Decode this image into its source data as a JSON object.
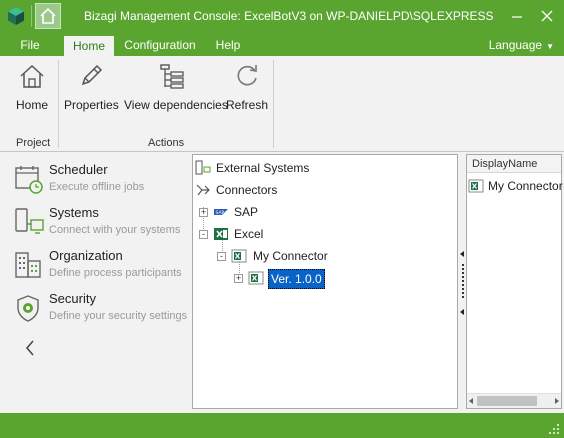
{
  "window": {
    "title": "Bizagi Management Console: ExcelBotV3 on WP-DANIELPD\\SQLEXPRESS",
    "controls": [
      "minimize",
      "close"
    ],
    "accent_color": "#5aa530"
  },
  "ribbon": {
    "tabs": [
      {
        "label": "File",
        "active": false
      },
      {
        "label": "Home",
        "active": true
      },
      {
        "label": "Configuration",
        "active": false
      },
      {
        "label": "Help",
        "active": false
      }
    ],
    "language_label": "Language",
    "buttons": {
      "home": {
        "label": "Home",
        "icon": "home-icon"
      },
      "properties": {
        "label": "Properties",
        "icon": "pencil-icon"
      },
      "view_dependencies": {
        "label": "View dependencies",
        "icon": "dependencies-icon"
      },
      "refresh": {
        "label": "Refresh",
        "icon": "refresh-icon"
      }
    },
    "groups": {
      "project": "Project",
      "actions": "Actions"
    }
  },
  "sidebar": {
    "items": [
      {
        "title": "Scheduler",
        "description": "Execute offline jobs",
        "icon": "calendar-clock-icon"
      },
      {
        "title": "Systems",
        "description": "Connect with your systems",
        "icon": "systems-icon"
      },
      {
        "title": "Organization",
        "description": "Define process participants",
        "icon": "organization-icon"
      },
      {
        "title": "Security",
        "description": "Define your security settings",
        "icon": "shield-icon"
      }
    ],
    "collapse_icon": "chevron-left-icon"
  },
  "tree": {
    "nodes": [
      {
        "label": "External Systems",
        "icon": "external-systems-icon"
      },
      {
        "label": "Connectors",
        "icon": "connectors-icon"
      },
      {
        "label": "SAP",
        "icon": "sap-icon",
        "expander": "+"
      },
      {
        "label": "Excel",
        "icon": "excel-icon",
        "expander": "-"
      },
      {
        "label": "My Connector",
        "icon": "connector-icon",
        "expander": "-"
      },
      {
        "label": "Ver. 1.0.0",
        "icon": "connector-version-icon",
        "expander": "+",
        "selected": true
      }
    ]
  },
  "details": {
    "column_header": "DisplayName",
    "rows": [
      {
        "label": "My Connector",
        "icon": "connector-icon"
      }
    ]
  }
}
